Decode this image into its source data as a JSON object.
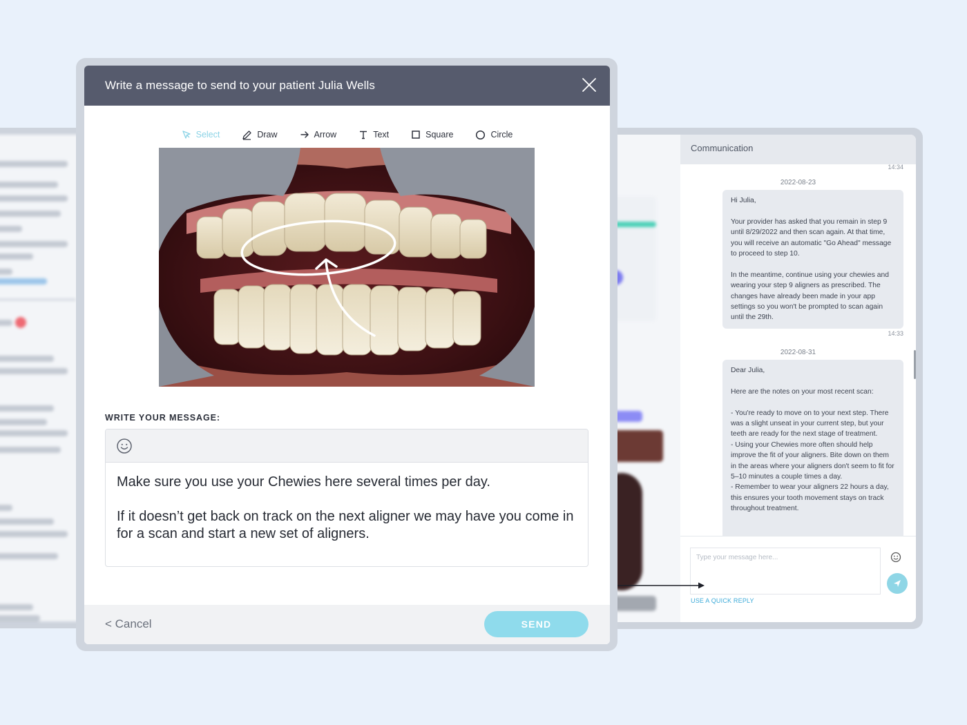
{
  "modal": {
    "title": "Write a message to send to your patient Julia Wells",
    "toolbar": [
      {
        "label": "Select",
        "icon": "cursor-icon",
        "active": true
      },
      {
        "label": "Draw",
        "icon": "pencil-icon"
      },
      {
        "label": "Arrow",
        "icon": "arrow-right-icon"
      },
      {
        "label": "Text",
        "icon": "text-icon"
      },
      {
        "label": "Square",
        "icon": "square-icon"
      },
      {
        "label": "Circle",
        "icon": "circle-icon"
      }
    ],
    "message_label": "WRITE YOUR MESSAGE:",
    "message_lines": [
      "Make sure you use your Chewies here several times per day.",
      "If it doesn’t get back on track on the next aligner we may have you come in for a scan and start a new set of aligners."
    ],
    "cancel_label": "< Cancel",
    "send_label": "SEND"
  },
  "communication": {
    "header": "Communication",
    "time_top": "14:34",
    "messages": [
      {
        "date": "2022-08-23",
        "paragraphs": [
          "Hi Julia,",
          "Your provider has asked that you remain in step 9 until 8/29/2022 and then scan again. At that time, you will receive an automatic \"Go Ahead\" message to proceed to step 10.",
          "In the meantime, continue using your chewies and wearing your step 9 aligners as prescribed. The changes have already been made in your app settings so you won't be prompted to scan again until the 29th."
        ],
        "time": "14:33"
      },
      {
        "date": "2022-08-31",
        "paragraphs": [
          "Dear Julia,",
          "Here are the notes on your most recent scan:",
          "- You're ready to move on to your next step. There was a slight unseat in your current step, but your teeth are ready for the next stage of treatment.\n- Using your Chewies more often should help improve the fit of your aligners. Bite down on them in the areas where your aligners don't seem to fit for 5–10 minutes a couple times a day.\n- Remember to wear your aligners 22 hours a day, this ensures your tooth movement stays on track throughout treatment."
        ]
      }
    ],
    "input_placeholder": "Type your message here...",
    "quick_reply": "USE A QUICK REPLY"
  },
  "colors": {
    "header_bg": "#565b6d",
    "accent": "#8fdbec",
    "page_bg": "#e9f1fb"
  }
}
